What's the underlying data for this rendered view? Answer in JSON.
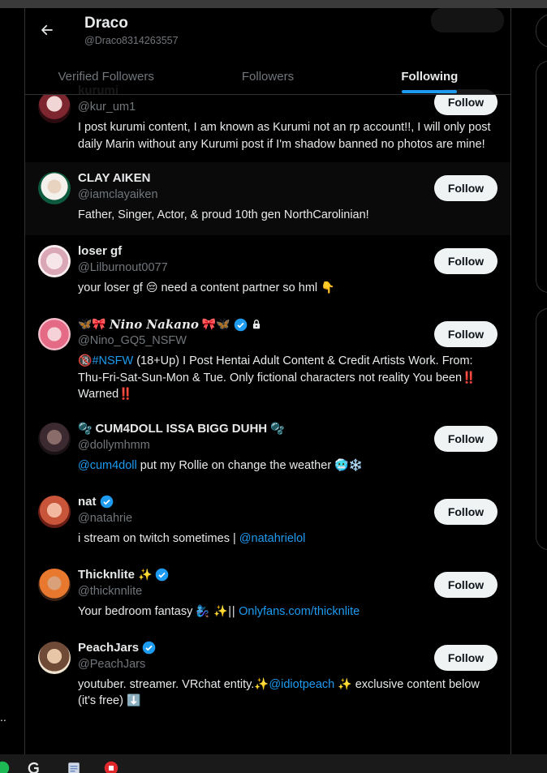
{
  "header": {
    "back_icon": "arrow-left-icon",
    "name": "Draco",
    "handle": "@Draco8314263557"
  },
  "tabs": [
    {
      "label": "Verified Followers",
      "active": false
    },
    {
      "label": "Followers",
      "active": false
    },
    {
      "label": "Following",
      "active": true
    }
  ],
  "users": [
    {
      "name": "kurumi",
      "handle": "@kur_um1",
      "bio": "I post kurumi content, I am known as Kurumi not an rp account!!, I will only post daily Marin without any Kurumi post if I'm shadow banned no photos are mine!",
      "button": "Follow"
    },
    {
      "name": "CLAY AIKEN",
      "handle": "@iamclayaiken",
      "bio": "Father, Singer, Actor, & proud 10th gen NorthCarolinian!",
      "button": "Follow"
    },
    {
      "name": "loser gf",
      "handle": "@Lilburnout0077",
      "bio_text": "your loser gf",
      "bio_emoji1": "😔",
      "bio_text2": "need a content partner so hml",
      "bio_emoji2": "👇",
      "button": "Follow"
    },
    {
      "name_prefix": "🦋🎀",
      "name": "𝑵𝒊𝒏𝒐 𝑵𝒂𝒌𝒂𝒏𝒐",
      "name_suffix": "🎀🦋",
      "handle": "@Nino_GQ5_NSFW",
      "bio_badge": "🔞",
      "bio_link": "#NSFW",
      "bio": "(18+Up) I Post Hentai Adult Content & Credit Artists Work. From: Thu-Fri-Sat-Sun-Mon & Tue. Only fictional characters not reality You been",
      "bio_mark1": "‼️",
      "bio_end": "Warned",
      "bio_mark2": "‼️",
      "button": "Follow"
    },
    {
      "name_prefix": "🫧",
      "name": "CUM4DOLL ISSA BIGG DUHH",
      "name_suffix": "🫧",
      "handle": "@dollymhmm",
      "bio_link": "@cum4doll",
      "bio": "put my Rollie on change the weather",
      "bio_emoji": "🥶❄️",
      "button": "Follow"
    },
    {
      "name": "nat",
      "handle": "@natahrie",
      "bio": "i stream on twitch sometimes |",
      "bio_link": "@natahrielol",
      "button": "Follow"
    },
    {
      "name": "Thicknlite",
      "name_suffix": "✨",
      "handle": "@thicknnlite",
      "bio": "Your bedroom fantasy",
      "bio_emoji": "🧞‍♀️ ✨||",
      "bio_link": "Onlyfans.com/thicknlite",
      "button": "Follow"
    },
    {
      "name": "PeachJars",
      "handle": "@PeachJars",
      "bio": "youtuber. streamer. VRchat entity.✨",
      "bio_link": "@idiotpeach",
      "bio_emoji": "✨",
      "bio_end": "exclusive content below (it's free)",
      "bio_emoji2": "⬇️",
      "button": "Follow"
    }
  ],
  "sidebar_dots": "..",
  "colors": {
    "accent": "#1d9bf0",
    "bg": "#000000",
    "muted": "#71767b",
    "button_bg": "#eff3f4"
  },
  "icons": [
    "arrow-left-icon",
    "verified-badge-icon",
    "lock-icon",
    "taskbar-spotify-icon",
    "taskbar-g-icon",
    "taskbar-notepad-icon",
    "taskbar-app-icon"
  ]
}
